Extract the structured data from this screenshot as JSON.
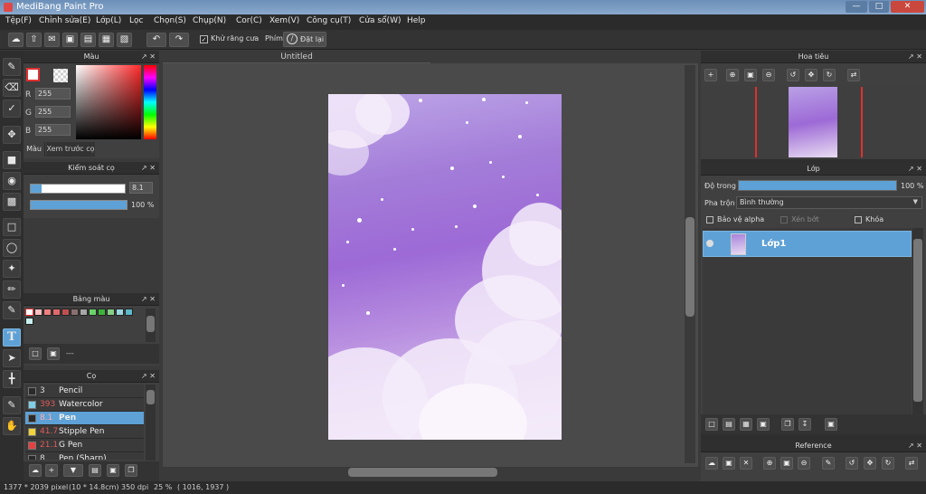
{
  "app": {
    "title": "MediBang Paint Pro"
  },
  "menu": [
    "Tệp(F)",
    "Chỉnh sửa(E)",
    "Lớp(L)",
    "Lọc",
    "Chọn(S)",
    "Chụp(N)",
    "Cor(C)",
    "Xem(V)",
    "Công cụ(T)",
    "Cửa sổ(W)",
    "Help"
  ],
  "toolbar": {
    "antialias_label": "Khử răng cưa",
    "key_label": "Phím",
    "reset_label": "Đặt lại"
  },
  "color_panel": {
    "title": "Màu",
    "r_label": "R",
    "r_value": "255",
    "g_label": "G",
    "g_value": "255",
    "b_label": "B",
    "b_value": "255",
    "tab_color": "Màu",
    "tab_preview": "Xem trước cọ"
  },
  "brush_control": {
    "title": "Kiểm soát cọ",
    "size_value": "8.1",
    "opacity_value": "100 %",
    "opacity_fraction": 1.0
  },
  "palette": {
    "title": "Bảng màu",
    "colors": [
      "#ffffff",
      "#ffbfbf",
      "#f08080",
      "#e06a6a",
      "#c05050",
      "#8a7070",
      "#a7a7a7",
      "#6bd36b",
      "#3cb43c",
      "#86d086",
      "#9ad6e0",
      "#5db8c8",
      "#c8f0f0"
    ],
    "footer_text": "---"
  },
  "brush_panel": {
    "title": "Cọ",
    "items": [
      {
        "size": "3",
        "name": "Pencil",
        "color": "#2a2a2a"
      },
      {
        "size": "393",
        "name": "Watercolor",
        "color": "#7ecfe8"
      },
      {
        "size": "8.1",
        "name": "Pen",
        "color": "#2a2a2a"
      },
      {
        "size": "41.7",
        "name": "Stipple Pen",
        "color": "#f2d23a"
      },
      {
        "size": "21.1",
        "name": "G Pen",
        "color": "#e84040"
      },
      {
        "size": "8",
        "name": "Pen (Sharp)",
        "color": "#2a2a2a"
      }
    ]
  },
  "document": {
    "tab_title": "Untitled"
  },
  "navigator": {
    "title": "Hoa tiêu"
  },
  "layer_panel": {
    "title": "Lớp",
    "opacity_label": "Độ trong",
    "opacity_value": "100 %",
    "opacity_fraction": 1.0,
    "blend_label": "Pha trộn",
    "blend_value": "Bình thường",
    "protect_alpha": "Bảo vệ alpha",
    "clipping": "Xén bớt",
    "lock": "Khóa",
    "layers": [
      {
        "name": "Lớp1"
      }
    ]
  },
  "reference": {
    "title": "Reference"
  },
  "status": {
    "size": "1377 * 2039 pixel",
    "physical": "(10 * 14.8cm)",
    "dpi": "350 dpi",
    "zoom": "25 %",
    "coords": "( 1016, 1937 )"
  },
  "colors": {
    "accent": "#5ea1d6",
    "panel": "#404040",
    "dark": "#2b2b2b"
  }
}
